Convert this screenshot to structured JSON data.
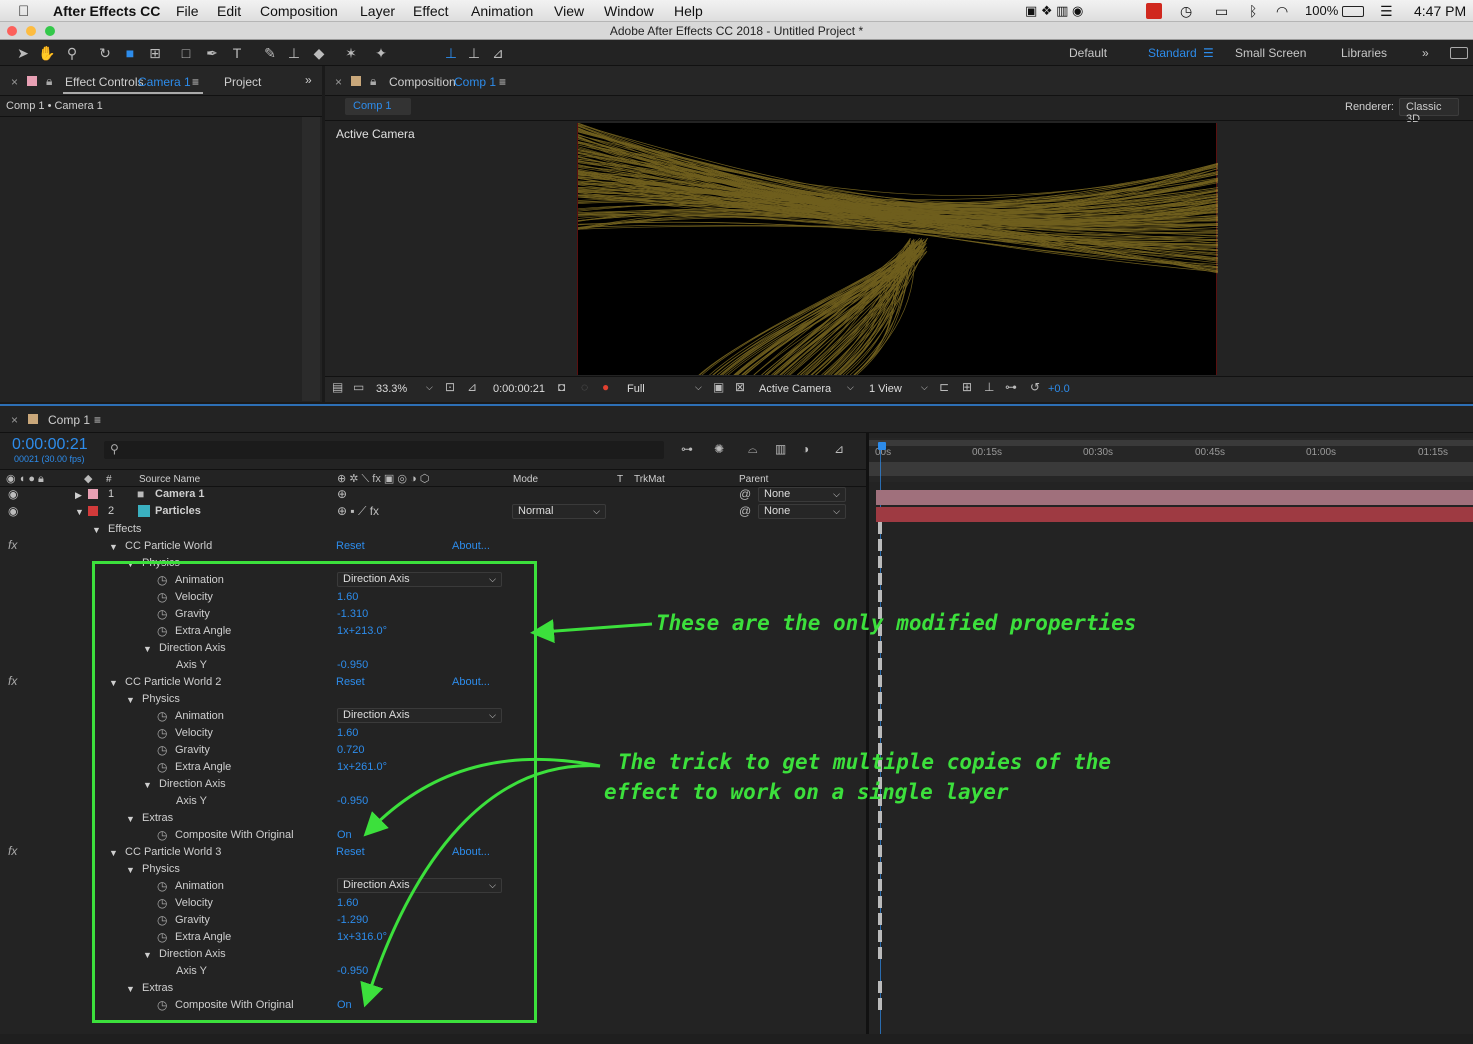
{
  "menubar": {
    "app": "After Effects CC",
    "items": [
      "File",
      "Edit",
      "Composition",
      "Layer",
      "Effect",
      "Animation",
      "View",
      "Window",
      "Help"
    ],
    "battery": "100%",
    "clock": "4:47 PM"
  },
  "window_title": "Adobe After Effects CC 2018 - Untitled Project *",
  "workspaces": {
    "default": "Default",
    "standard": "Standard",
    "small_screen": "Small Screen",
    "libraries": "Libraries"
  },
  "effect_controls": {
    "tab_prefix": "Effect Controls",
    "tab_layer": "Camera 1",
    "project_tab": "Project",
    "breadcrumb": "Comp 1 • Camera 1"
  },
  "composition": {
    "tab_prefix": "Composition",
    "tab_comp": "Comp 1",
    "comp_chip": "Comp 1",
    "renderer_label": "Renderer:",
    "renderer_value": "Classic 3D",
    "view_label": "Active Camera"
  },
  "viewer_footer": {
    "zoom": "33.3%",
    "timecode": "0:00:00:21",
    "resolution": "Full",
    "camera": "Active Camera",
    "views": "1 View",
    "exposure": "+0.0"
  },
  "timeline": {
    "tab": "Comp 1",
    "timecode": "0:00:00:21",
    "frame_info": "00021 (30.00 fps)",
    "search_placeholder": "",
    "headers": {
      "num": "#",
      "source": "Source Name",
      "mode": "Mode",
      "t": "T",
      "trkmat": "TrkMat",
      "parent": "Parent"
    },
    "ruler": [
      "00s",
      "00:15s",
      "00:30s",
      "00:45s",
      "01:00s",
      "01:15s"
    ],
    "layers": [
      {
        "num": "1",
        "name": "Camera 1",
        "parent": "None",
        "color": "#e8a0b4"
      },
      {
        "num": "2",
        "name": "Particles",
        "mode": "Normal",
        "parent": "None",
        "color": "#d23a3a"
      }
    ],
    "effects_label": "Effects",
    "effects": [
      {
        "name": "CC Particle World",
        "reset": "Reset",
        "about": "About...",
        "physics": "Physics",
        "animation_label": "Animation",
        "animation": "Direction Axis",
        "velocity_label": "Velocity",
        "velocity": "1.60",
        "gravity_label": "Gravity",
        "gravity": "-1.310",
        "extra_angle_label": "Extra Angle",
        "extra_angle": "1x+213.0°",
        "direction_axis": "Direction Axis",
        "axis_y_label": "Axis Y",
        "axis_y": "-0.950"
      },
      {
        "name": "CC Particle World 2",
        "reset": "Reset",
        "about": "About...",
        "physics": "Physics",
        "animation_label": "Animation",
        "animation": "Direction Axis",
        "velocity_label": "Velocity",
        "velocity": "1.60",
        "gravity_label": "Gravity",
        "gravity": "0.720",
        "extra_angle_label": "Extra Angle",
        "extra_angle": "1x+261.0°",
        "direction_axis": "Direction Axis",
        "axis_y_label": "Axis Y",
        "axis_y": "-0.950",
        "extras": "Extras",
        "composite_label": "Composite With Original",
        "composite": "On"
      },
      {
        "name": "CC Particle World 3",
        "reset": "Reset",
        "about": "About...",
        "physics": "Physics",
        "animation_label": "Animation",
        "animation": "Direction Axis",
        "velocity_label": "Velocity",
        "velocity": "1.60",
        "gravity_label": "Gravity",
        "gravity": "-1.290",
        "extra_angle_label": "Extra Angle",
        "extra_angle": "1x+316.0°",
        "direction_axis": "Direction Axis",
        "axis_y_label": "Axis Y",
        "axis_y": "-0.950",
        "extras": "Extras",
        "composite_label": "Composite With Original",
        "composite": "On"
      }
    ]
  },
  "annotations": {
    "modified": "These are the only modified properties",
    "trick_line1": "The trick to get multiple copies of the",
    "trick_line2": "effect to work on a single layer"
  },
  "colors": {
    "accent": "#2d8ceb",
    "annotation": "#3ce03c",
    "particles": "#c8a830"
  }
}
